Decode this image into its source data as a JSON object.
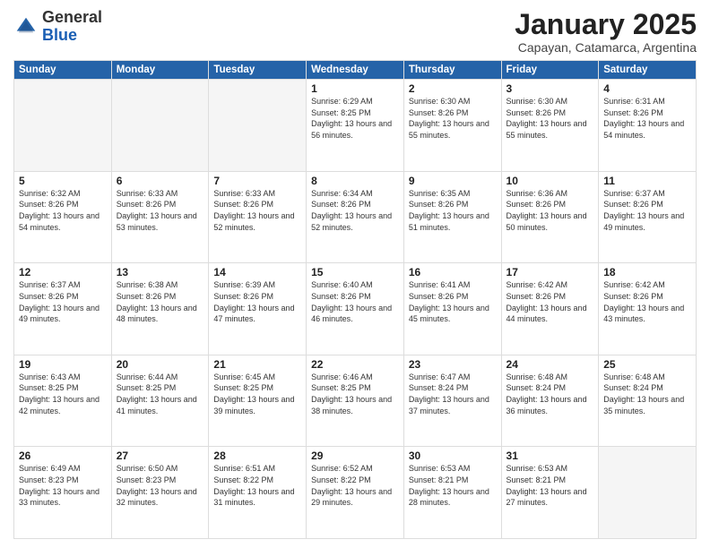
{
  "header": {
    "logo_general": "General",
    "logo_blue": "Blue",
    "month_year": "January 2025",
    "location": "Capayan, Catamarca, Argentina"
  },
  "days_of_week": [
    "Sunday",
    "Monday",
    "Tuesday",
    "Wednesday",
    "Thursday",
    "Friday",
    "Saturday"
  ],
  "weeks": [
    [
      {
        "day": "",
        "info": ""
      },
      {
        "day": "",
        "info": ""
      },
      {
        "day": "",
        "info": ""
      },
      {
        "day": "1",
        "info": "Sunrise: 6:29 AM\nSunset: 8:25 PM\nDaylight: 13 hours and 56 minutes."
      },
      {
        "day": "2",
        "info": "Sunrise: 6:30 AM\nSunset: 8:26 PM\nDaylight: 13 hours and 55 minutes."
      },
      {
        "day": "3",
        "info": "Sunrise: 6:30 AM\nSunset: 8:26 PM\nDaylight: 13 hours and 55 minutes."
      },
      {
        "day": "4",
        "info": "Sunrise: 6:31 AM\nSunset: 8:26 PM\nDaylight: 13 hours and 54 minutes."
      }
    ],
    [
      {
        "day": "5",
        "info": "Sunrise: 6:32 AM\nSunset: 8:26 PM\nDaylight: 13 hours and 54 minutes."
      },
      {
        "day": "6",
        "info": "Sunrise: 6:33 AM\nSunset: 8:26 PM\nDaylight: 13 hours and 53 minutes."
      },
      {
        "day": "7",
        "info": "Sunrise: 6:33 AM\nSunset: 8:26 PM\nDaylight: 13 hours and 52 minutes."
      },
      {
        "day": "8",
        "info": "Sunrise: 6:34 AM\nSunset: 8:26 PM\nDaylight: 13 hours and 52 minutes."
      },
      {
        "day": "9",
        "info": "Sunrise: 6:35 AM\nSunset: 8:26 PM\nDaylight: 13 hours and 51 minutes."
      },
      {
        "day": "10",
        "info": "Sunrise: 6:36 AM\nSunset: 8:26 PM\nDaylight: 13 hours and 50 minutes."
      },
      {
        "day": "11",
        "info": "Sunrise: 6:37 AM\nSunset: 8:26 PM\nDaylight: 13 hours and 49 minutes."
      }
    ],
    [
      {
        "day": "12",
        "info": "Sunrise: 6:37 AM\nSunset: 8:26 PM\nDaylight: 13 hours and 49 minutes."
      },
      {
        "day": "13",
        "info": "Sunrise: 6:38 AM\nSunset: 8:26 PM\nDaylight: 13 hours and 48 minutes."
      },
      {
        "day": "14",
        "info": "Sunrise: 6:39 AM\nSunset: 8:26 PM\nDaylight: 13 hours and 47 minutes."
      },
      {
        "day": "15",
        "info": "Sunrise: 6:40 AM\nSunset: 8:26 PM\nDaylight: 13 hours and 46 minutes."
      },
      {
        "day": "16",
        "info": "Sunrise: 6:41 AM\nSunset: 8:26 PM\nDaylight: 13 hours and 45 minutes."
      },
      {
        "day": "17",
        "info": "Sunrise: 6:42 AM\nSunset: 8:26 PM\nDaylight: 13 hours and 44 minutes."
      },
      {
        "day": "18",
        "info": "Sunrise: 6:42 AM\nSunset: 8:26 PM\nDaylight: 13 hours and 43 minutes."
      }
    ],
    [
      {
        "day": "19",
        "info": "Sunrise: 6:43 AM\nSunset: 8:25 PM\nDaylight: 13 hours and 42 minutes."
      },
      {
        "day": "20",
        "info": "Sunrise: 6:44 AM\nSunset: 8:25 PM\nDaylight: 13 hours and 41 minutes."
      },
      {
        "day": "21",
        "info": "Sunrise: 6:45 AM\nSunset: 8:25 PM\nDaylight: 13 hours and 39 minutes."
      },
      {
        "day": "22",
        "info": "Sunrise: 6:46 AM\nSunset: 8:25 PM\nDaylight: 13 hours and 38 minutes."
      },
      {
        "day": "23",
        "info": "Sunrise: 6:47 AM\nSunset: 8:24 PM\nDaylight: 13 hours and 37 minutes."
      },
      {
        "day": "24",
        "info": "Sunrise: 6:48 AM\nSunset: 8:24 PM\nDaylight: 13 hours and 36 minutes."
      },
      {
        "day": "25",
        "info": "Sunrise: 6:48 AM\nSunset: 8:24 PM\nDaylight: 13 hours and 35 minutes."
      }
    ],
    [
      {
        "day": "26",
        "info": "Sunrise: 6:49 AM\nSunset: 8:23 PM\nDaylight: 13 hours and 33 minutes."
      },
      {
        "day": "27",
        "info": "Sunrise: 6:50 AM\nSunset: 8:23 PM\nDaylight: 13 hours and 32 minutes."
      },
      {
        "day": "28",
        "info": "Sunrise: 6:51 AM\nSunset: 8:22 PM\nDaylight: 13 hours and 31 minutes."
      },
      {
        "day": "29",
        "info": "Sunrise: 6:52 AM\nSunset: 8:22 PM\nDaylight: 13 hours and 29 minutes."
      },
      {
        "day": "30",
        "info": "Sunrise: 6:53 AM\nSunset: 8:21 PM\nDaylight: 13 hours and 28 minutes."
      },
      {
        "day": "31",
        "info": "Sunrise: 6:53 AM\nSunset: 8:21 PM\nDaylight: 13 hours and 27 minutes."
      },
      {
        "day": "",
        "info": ""
      }
    ]
  ]
}
